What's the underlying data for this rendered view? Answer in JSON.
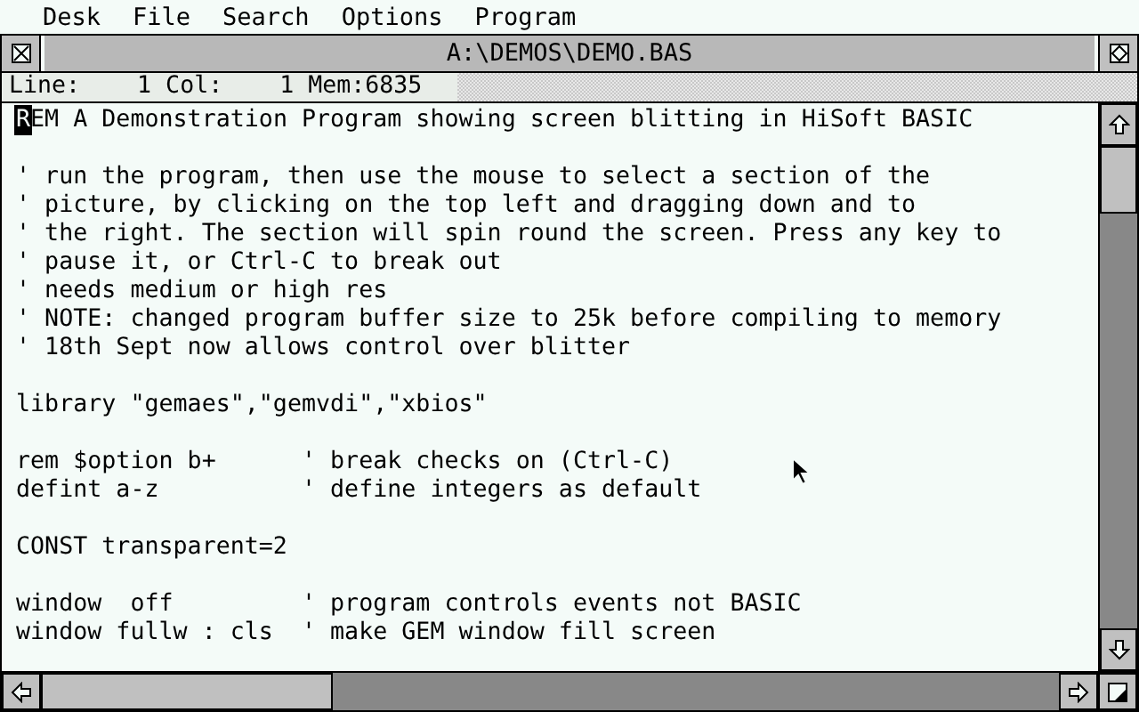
{
  "menu_bar": {
    "items": [
      {
        "label": "Desk"
      },
      {
        "label": "File"
      },
      {
        "label": "Search"
      },
      {
        "label": "Options"
      },
      {
        "label": "Program"
      }
    ]
  },
  "window": {
    "title": "A:\\DEMOS\\DEMO.BAS"
  },
  "status_line": "Line:    1 Col:    1 Mem:6835",
  "editor": {
    "lines": [
      {
        "kind": "code",
        "text": "REM A Demonstration Program showing screen blitting in HiSoft BASIC",
        "cursor": true
      },
      {
        "kind": "blank"
      },
      {
        "kind": "code",
        "text": "' run the program, then use the mouse to select a section of the",
        "cursor": false
      },
      {
        "kind": "code",
        "text": "' picture, by clicking on the top left and dragging down and to",
        "cursor": false
      },
      {
        "kind": "code",
        "text": "' the right. The section will spin round the screen. Press any key to",
        "cursor": false
      },
      {
        "kind": "code",
        "text": "' pause it, or Ctrl-C to break out",
        "cursor": false
      },
      {
        "kind": "code",
        "text": "' needs medium or high res",
        "cursor": false
      },
      {
        "kind": "code",
        "text": "' NOTE: changed program buffer size to 25k before compiling to memory",
        "cursor": false
      },
      {
        "kind": "code",
        "text": "' 18th Sept now allows control over blitter",
        "cursor": false
      },
      {
        "kind": "blank"
      },
      {
        "kind": "code",
        "text": "library \"gemaes\",\"gemvdi\",\"xbios\"",
        "cursor": false
      },
      {
        "kind": "blank"
      },
      {
        "kind": "code",
        "text": "rem $option b+      ' break checks on (Ctrl-C)",
        "cursor": false
      },
      {
        "kind": "code",
        "text": "defint a-z          ' define integers as default",
        "cursor": false
      },
      {
        "kind": "blank"
      },
      {
        "kind": "code",
        "text": "CONST transparent=2",
        "cursor": false
      },
      {
        "kind": "blank"
      },
      {
        "kind": "code",
        "text": "window  off         ' program controls events not BASIC",
        "cursor": false
      },
      {
        "kind": "code",
        "text": "window fullw : cls  ' make GEM window fill screen",
        "cursor": false
      }
    ]
  }
}
